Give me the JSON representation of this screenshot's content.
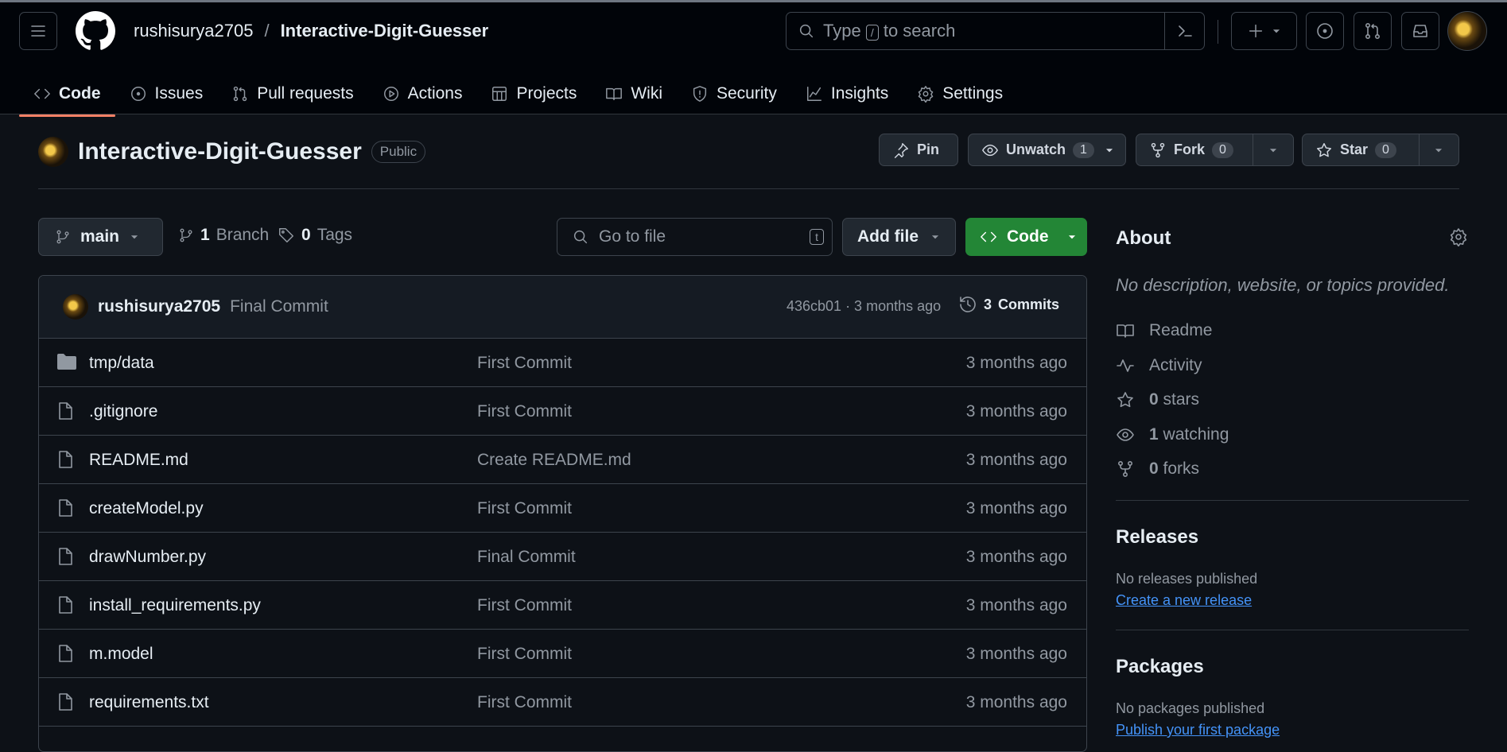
{
  "header": {
    "owner": "rushisurya2705",
    "separator": "/",
    "repo": "Interactive-Digit-Guesser",
    "search_pre": "Type",
    "search_key": "/",
    "search_post": "to search"
  },
  "tabs": [
    {
      "label": "Code",
      "icon": "code-icon"
    },
    {
      "label": "Issues",
      "icon": "issue-icon"
    },
    {
      "label": "Pull requests",
      "icon": "pull-request-icon"
    },
    {
      "label": "Actions",
      "icon": "play-icon"
    },
    {
      "label": "Projects",
      "icon": "table-icon"
    },
    {
      "label": "Wiki",
      "icon": "book-icon"
    },
    {
      "label": "Security",
      "icon": "shield-icon"
    },
    {
      "label": "Insights",
      "icon": "graph-icon"
    },
    {
      "label": "Settings",
      "icon": "gear-icon"
    }
  ],
  "repo_head": {
    "name": "Interactive-Digit-Guesser",
    "visibility": "Public",
    "pin": "Pin",
    "unwatch": "Unwatch",
    "watch_count": "1",
    "fork": "Fork",
    "fork_count": "0",
    "star": "Star",
    "star_count": "0"
  },
  "branch": {
    "name": "main",
    "branches_count": "1",
    "branches_label": "Branch",
    "tags_count": "0",
    "tags_label": "Tags",
    "goto_placeholder": "Go to file",
    "goto_key": "t",
    "add_file": "Add file",
    "code": "Code"
  },
  "latest_commit": {
    "author": "rushisurya2705",
    "message": "Final Commit",
    "sha_age": "436cb01 · 3 months ago",
    "commits_count": "3",
    "commits_label": "Commits"
  },
  "files": [
    {
      "name": "tmp/data",
      "type": "folder",
      "message": "First Commit",
      "age": "3 months ago"
    },
    {
      "name": ".gitignore",
      "type": "file",
      "message": "First Commit",
      "age": "3 months ago"
    },
    {
      "name": "README.md",
      "type": "file",
      "message": "Create README.md",
      "age": "3 months ago"
    },
    {
      "name": "createModel.py",
      "type": "file",
      "message": "First Commit",
      "age": "3 months ago"
    },
    {
      "name": "drawNumber.py",
      "type": "file",
      "message": "Final Commit",
      "age": "3 months ago"
    },
    {
      "name": "install_requirements.py",
      "type": "file",
      "message": "First Commit",
      "age": "3 months ago"
    },
    {
      "name": "m.model",
      "type": "file",
      "message": "First Commit",
      "age": "3 months ago"
    },
    {
      "name": "requirements.txt",
      "type": "file",
      "message": "First Commit",
      "age": "3 months ago"
    }
  ],
  "about": {
    "title": "About",
    "description": "No description, website, or topics provided.",
    "readme": "Readme",
    "activity": "Activity",
    "stars_count": "0",
    "stars_label": "stars",
    "watching_count": "1",
    "watching_label": "watching",
    "forks_count": "0",
    "forks_label": "forks"
  },
  "releases": {
    "title": "Releases",
    "none": "No releases published",
    "create": "Create a new release"
  },
  "packages": {
    "title": "Packages",
    "none": "No packages published",
    "publish": "Publish your first package"
  }
}
